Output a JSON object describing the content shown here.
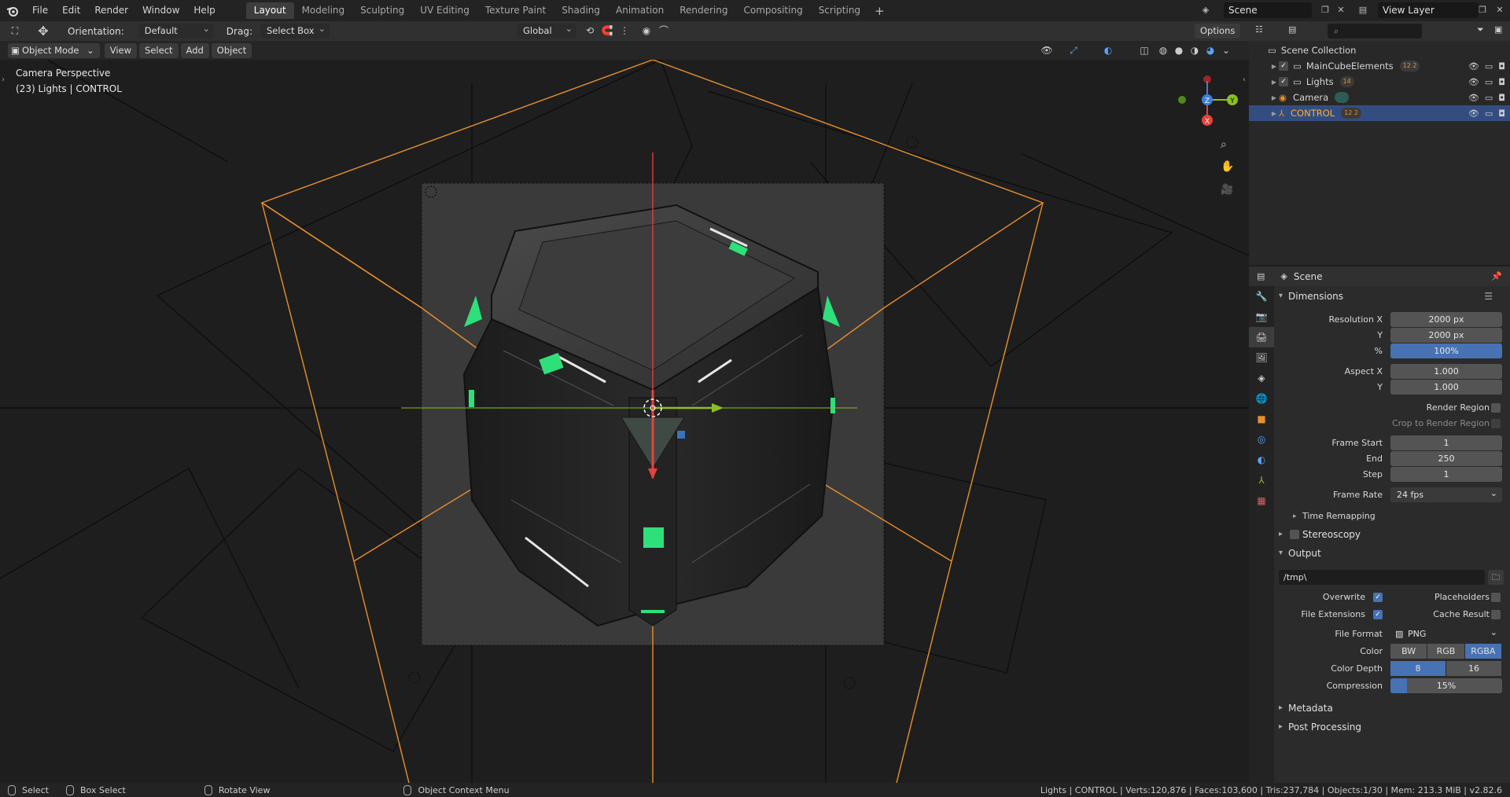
{
  "menubar": {
    "items": [
      "File",
      "Edit",
      "Render",
      "Window",
      "Help"
    ],
    "workspaces": [
      "Layout",
      "Modeling",
      "Sculpting",
      "UV Editing",
      "Texture Paint",
      "Shading",
      "Animation",
      "Rendering",
      "Compositing",
      "Scripting"
    ],
    "active_workspace": "Layout",
    "add_label": "+",
    "scene_name": "Scene",
    "view_layer": "View Layer"
  },
  "viewport_header": {
    "orientation_label": "Orientation:",
    "orientation_value": "Default",
    "drag_label": "Drag:",
    "drag_value": "Select Box",
    "transform_orientation": "Global",
    "options_label": "Options"
  },
  "viewport_menu": {
    "mode": "Object Mode",
    "items": [
      "View",
      "Select",
      "Add",
      "Object"
    ]
  },
  "viewport": {
    "perspective_label": "Camera Perspective",
    "context_label": "(23) Lights | CONTROL",
    "axes": {
      "z": "Z",
      "y": "Y",
      "x": "X"
    },
    "colors": {
      "accent_orange": "#e8902c",
      "axis_x": "#e8413b",
      "axis_y": "#8bc021",
      "axis_z": "#3d7ed6",
      "glow_green": "#2ee07a"
    }
  },
  "outliner": {
    "root": "Scene Collection",
    "rows": [
      {
        "name": "MainCubeElements",
        "badge": "12 2"
      },
      {
        "name": "Lights",
        "badge": "14"
      },
      {
        "name": "Camera",
        "badge": ""
      },
      {
        "name": "CONTROL",
        "badge": "12 2"
      }
    ],
    "selected": "CONTROL"
  },
  "properties": {
    "header_scene": "Scene",
    "dimensions": {
      "title": "Dimensions",
      "resolution_x_label": "Resolution X",
      "resolution_x": "2000 px",
      "resolution_y_label": "Y",
      "resolution_y": "2000 px",
      "percent_label": "%",
      "percent": "100%",
      "aspect_x_label": "Aspect X",
      "aspect_x": "1.000",
      "aspect_y_label": "Y",
      "aspect_y": "1.000",
      "render_region_label": "Render Region",
      "crop_label": "Crop to Render Region",
      "frame_start_label": "Frame Start",
      "frame_start": "1",
      "end_label": "End",
      "end": "250",
      "step_label": "Step",
      "step": "1",
      "frame_rate_label": "Frame Rate",
      "frame_rate": "24 fps",
      "time_remapping": "Time Remapping"
    },
    "stereoscopy": "Stereoscopy",
    "output": {
      "title": "Output",
      "path": "/tmp\\",
      "overwrite_label": "Overwrite",
      "placeholders_label": "Placeholders",
      "file_ext_label": "File Extensions",
      "cache_label": "Cache Result",
      "file_format_label": "File Format",
      "file_format": "PNG",
      "color_label": "Color",
      "color_options": [
        "BW",
        "RGB",
        "RGBA"
      ],
      "color_selected": "RGBA",
      "depth_label": "Color Depth",
      "depth_options": [
        "8",
        "16"
      ],
      "depth_selected": "8",
      "compression_label": "Compression",
      "compression": "15%",
      "compression_fraction": 0.15
    },
    "metadata": "Metadata",
    "post_processing": "Post Processing"
  },
  "statusbar": {
    "select": "Select",
    "box_select": "Box Select",
    "rotate_view": "Rotate View",
    "context_menu": "Object Context Menu",
    "stats": "Lights | CONTROL | Verts:120,876 | Faces:103,600 | Tris:237,784 | Objects:1/30 | Mem: 213.3 MiB | v2.82.6"
  }
}
